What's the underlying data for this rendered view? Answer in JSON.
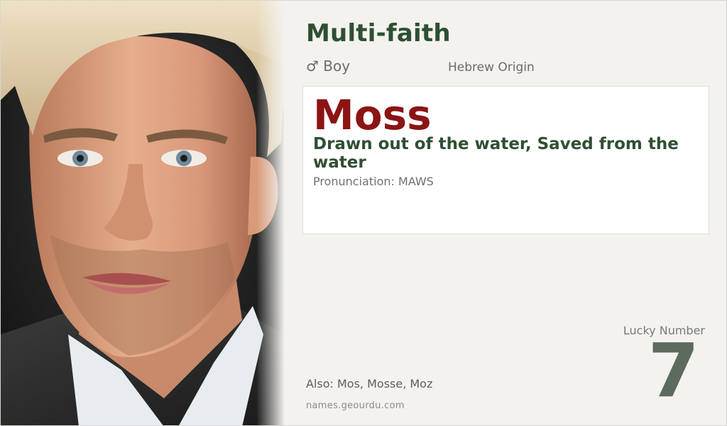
{
  "category": "Multi-faith",
  "gender": {
    "symbol": "♂",
    "label": "Boy"
  },
  "origin": "Hebrew Origin",
  "name": "Moss",
  "meaning": "Drawn out of the water, Saved from the water",
  "pronunciation": "Pronunciation: MAWS",
  "also": "Also: Mos, Mosse, Moz",
  "site": "names.geourdu.com",
  "lucky": {
    "label": "Lucky Number",
    "value": "7"
  },
  "colors": {
    "category": "#2f4f32",
    "name": "#8b1414",
    "meaning": "#2f4f32",
    "lucky_number": "#5d6a5e",
    "background": "#f3f2ef"
  },
  "icons": {
    "gender": "male-symbol-icon"
  }
}
